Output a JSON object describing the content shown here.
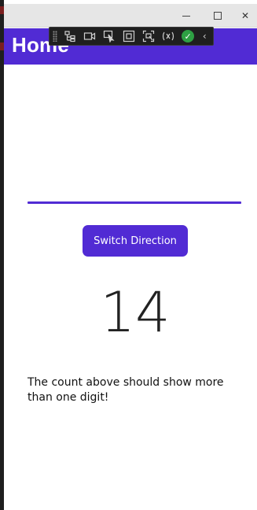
{
  "window": {
    "title_bar": {
      "minimize_icon": "minimize-icon",
      "maximize_icon": "maximize-icon",
      "close_label": "✕"
    }
  },
  "app_bar": {
    "title": "Home",
    "background": "#512bd4"
  },
  "debug_toolbar": {
    "tools": [
      "live-visual-tree-icon",
      "record-icon",
      "select-element-icon",
      "display-layout-adorners-icon",
      "track-focus-icon",
      "hot-reload-icon",
      "hot-reload-ok-icon",
      "collapse-toolbar-icon"
    ],
    "ok_glyph": "✓",
    "collapse_glyph": "‹"
  },
  "main": {
    "progress": {
      "value": 1.0,
      "color": "#512bd4"
    },
    "switch_button_label": "Switch Direction",
    "count": "14",
    "message": "The count above should show more than one digit!"
  }
}
